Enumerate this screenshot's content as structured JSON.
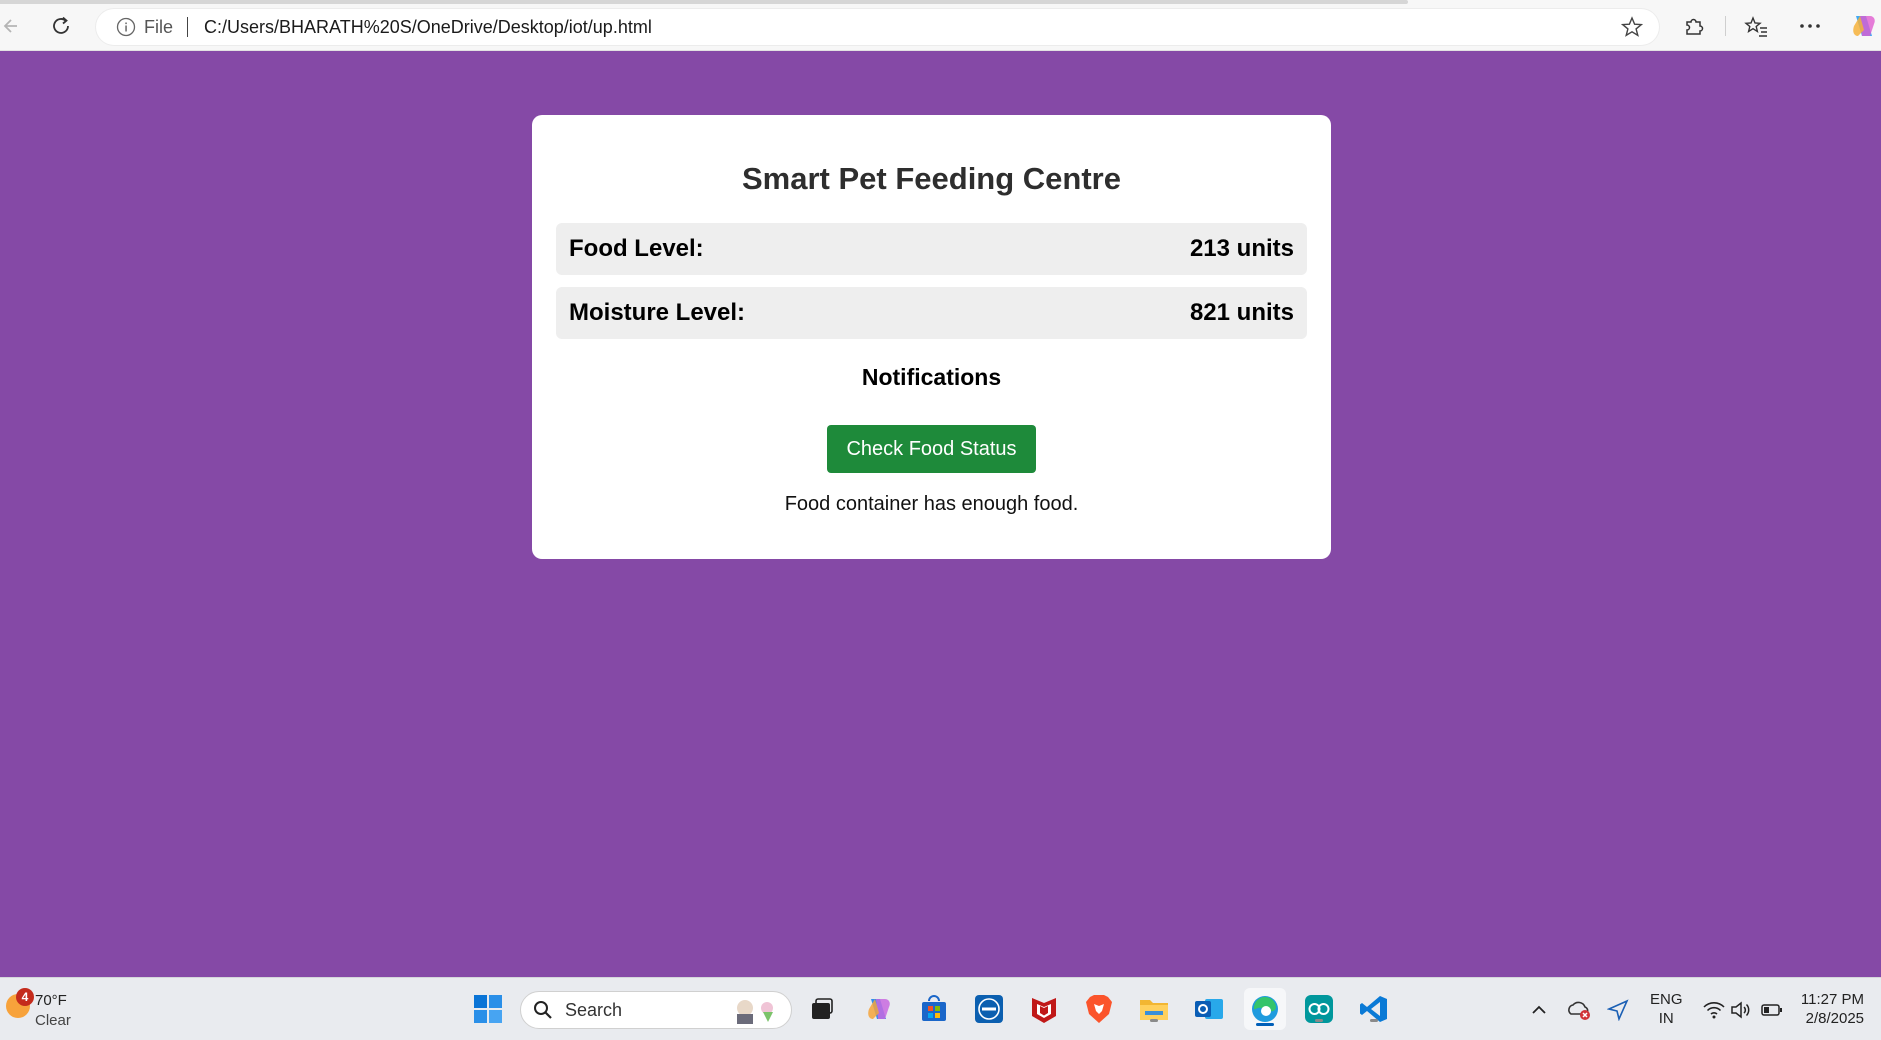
{
  "browser": {
    "site_info_label": "File",
    "url": "C:/Users/BHARATH%20S/OneDrive/Desktop/iot/up.html"
  },
  "page": {
    "title": "Smart Pet Feeding Centre",
    "food": {
      "label": "Food Level:",
      "value": "213 units"
    },
    "moisture": {
      "label": "Moisture Level:",
      "value": "821 units"
    },
    "notifications_heading": "Notifications",
    "check_button_label": "Check Food Status",
    "status_message": "Food container has enough food.",
    "colors": {
      "background": "#8549a6",
      "button": "#1e8a3a"
    }
  },
  "taskbar": {
    "weather": {
      "badge": "4",
      "temperature": "70°F",
      "condition": "Clear"
    },
    "search_label": "Search",
    "apps": [
      "start-icon",
      "search-icon",
      "task-view-icon",
      "copilot-icon",
      "store-icon",
      "dell-icon",
      "mcafee-icon",
      "brave-icon",
      "file-explorer-icon",
      "outlook-icon",
      "edge-icon",
      "arduino-icon",
      "vscode-icon"
    ],
    "tray": {
      "lang_line1": "ENG",
      "lang_line2": "IN",
      "time": "11:27 PM",
      "date": "2/8/2025"
    }
  }
}
